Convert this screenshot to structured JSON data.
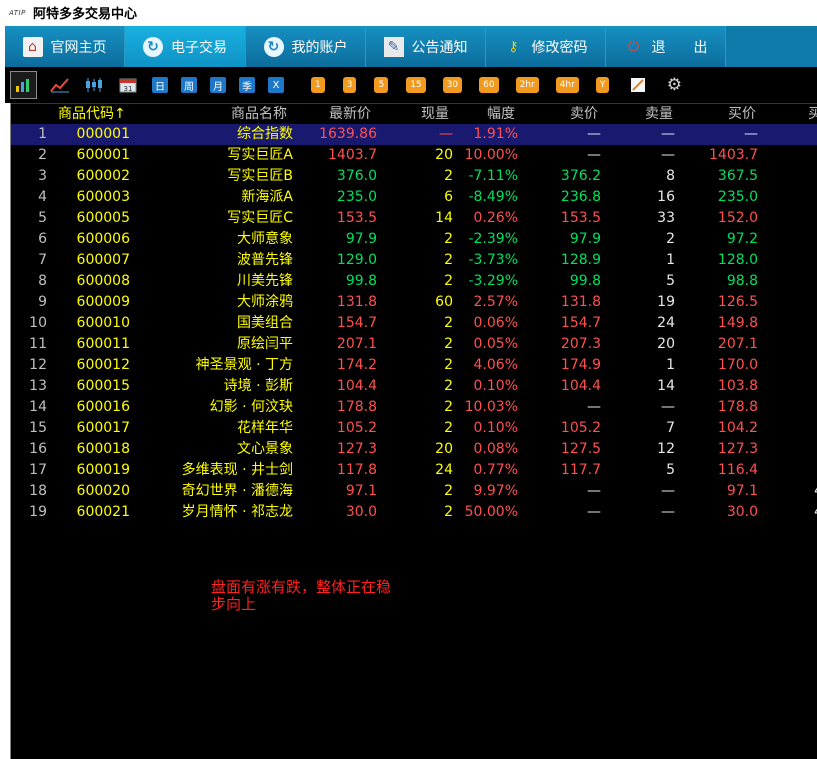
{
  "app": {
    "logo": "ATIP",
    "title": "阿特多多交易中心"
  },
  "nav": [
    {
      "label": "官网主页",
      "icon": "home-icon",
      "active": false
    },
    {
      "label": "电子交易",
      "icon": "trade-icon",
      "active": true
    },
    {
      "label": "我的账户",
      "icon": "account-icon",
      "active": false
    },
    {
      "label": "公告通知",
      "icon": "announcement-icon",
      "active": false
    },
    {
      "label": "修改密码",
      "icon": "key-icon",
      "active": false
    },
    {
      "label": "退　　出",
      "icon": "power-icon",
      "active": false
    }
  ],
  "toolbar": {
    "icons": [
      "bar-chart-icon",
      "line-chart-icon",
      "candlestick-icon",
      "calendar-icon"
    ],
    "periods": [
      "日",
      "周",
      "月",
      "季",
      "X"
    ],
    "intervals": [
      "1",
      "3",
      "5",
      "15",
      "30",
      "60",
      "2hr",
      "4hr",
      "Y"
    ],
    "tools": [
      "draw-icon",
      "gear-icon"
    ]
  },
  "table": {
    "headers": {
      "num": "",
      "code": "商品代码↑",
      "name": "商品名称",
      "last": "最新价",
      "vol": "现量",
      "change": "幅度",
      "ask": "卖价",
      "askvol": "卖量",
      "bid": "买价",
      "bidvol": "买"
    },
    "rows": [
      {
        "num": "1",
        "code": "000001",
        "name": "综合指数",
        "last": "1639.86",
        "vol": "—",
        "change": "1.91%",
        "ask": "—",
        "askvol": "—",
        "bid": "—",
        "bidvol": ""
      },
      {
        "num": "2",
        "code": "600001",
        "name": "写实巨匠A",
        "last": "1403.7",
        "vol": "20",
        "change": "10.00%",
        "ask": "—",
        "askvol": "—",
        "bid": "1403.7",
        "bidvol": ""
      },
      {
        "num": "3",
        "code": "600002",
        "name": "写实巨匠B",
        "last": "376.0",
        "vol": "2",
        "change": "-7.11%",
        "ask": "376.2",
        "askvol": "8",
        "bid": "367.5",
        "bidvol": ""
      },
      {
        "num": "4",
        "code": "600003",
        "name": "新海派A",
        "last": "235.0",
        "vol": "6",
        "change": "-8.49%",
        "ask": "236.8",
        "askvol": "16",
        "bid": "235.0",
        "bidvol": ""
      },
      {
        "num": "5",
        "code": "600005",
        "name": "写实巨匠C",
        "last": "153.5",
        "vol": "14",
        "change": "0.26%",
        "ask": "153.5",
        "askvol": "33",
        "bid": "152.0",
        "bidvol": ""
      },
      {
        "num": "6",
        "code": "600006",
        "name": "大师意象",
        "last": "97.9",
        "vol": "2",
        "change": "-2.39%",
        "ask": "97.9",
        "askvol": "2",
        "bid": "97.2",
        "bidvol": ""
      },
      {
        "num": "7",
        "code": "600007",
        "name": "波普先锋",
        "last": "129.0",
        "vol": "2",
        "change": "-3.73%",
        "ask": "128.9",
        "askvol": "1",
        "bid": "128.0",
        "bidvol": ""
      },
      {
        "num": "8",
        "code": "600008",
        "name": "川美先锋",
        "last": "99.8",
        "vol": "2",
        "change": "-3.29%",
        "ask": "99.8",
        "askvol": "5",
        "bid": "98.8",
        "bidvol": ""
      },
      {
        "num": "9",
        "code": "600009",
        "name": "大师涂鸦",
        "last": "131.8",
        "vol": "60",
        "change": "2.57%",
        "ask": "131.8",
        "askvol": "19",
        "bid": "126.5",
        "bidvol": ""
      },
      {
        "num": "10",
        "code": "600010",
        "name": "国美组合",
        "last": "154.7",
        "vol": "2",
        "change": "0.06%",
        "ask": "154.7",
        "askvol": "24",
        "bid": "149.8",
        "bidvol": ""
      },
      {
        "num": "11",
        "code": "600011",
        "name": "原绘闫平",
        "last": "207.1",
        "vol": "2",
        "change": "0.05%",
        "ask": "207.3",
        "askvol": "20",
        "bid": "207.1",
        "bidvol": ""
      },
      {
        "num": "12",
        "code": "600012",
        "name": "神圣景观 · 丁方",
        "last": "174.2",
        "vol": "2",
        "change": "4.06%",
        "ask": "174.9",
        "askvol": "1",
        "bid": "170.0",
        "bidvol": ""
      },
      {
        "num": "13",
        "code": "600015",
        "name": "诗境 · 彭斯",
        "last": "104.4",
        "vol": "2",
        "change": "0.10%",
        "ask": "104.4",
        "askvol": "14",
        "bid": "103.8",
        "bidvol": ""
      },
      {
        "num": "14",
        "code": "600016",
        "name": "幻影 · 何汶玦",
        "last": "178.8",
        "vol": "2",
        "change": "10.03%",
        "ask": "—",
        "askvol": "—",
        "bid": "178.8",
        "bidvol": ""
      },
      {
        "num": "15",
        "code": "600017",
        "name": "花样年华",
        "last": "105.2",
        "vol": "2",
        "change": "0.10%",
        "ask": "105.2",
        "askvol": "7",
        "bid": "104.2",
        "bidvol": ""
      },
      {
        "num": "16",
        "code": "600018",
        "name": "文心景象",
        "last": "127.3",
        "vol": "20",
        "change": "0.08%",
        "ask": "127.5",
        "askvol": "12",
        "bid": "127.3",
        "bidvol": ""
      },
      {
        "num": "17",
        "code": "600019",
        "name": "多维表现 · 井士剑",
        "last": "117.8",
        "vol": "24",
        "change": "0.77%",
        "ask": "117.7",
        "askvol": "5",
        "bid": "116.4",
        "bidvol": ""
      },
      {
        "num": "18",
        "code": "600020",
        "name": "奇幻世界 · 潘德海",
        "last": "97.1",
        "vol": "2",
        "change": "9.97%",
        "ask": "—",
        "askvol": "—",
        "bid": "97.1",
        "bidvol": "4"
      },
      {
        "num": "19",
        "code": "600021",
        "name": "岁月情怀 · 祁志龙",
        "last": "30.0",
        "vol": "2",
        "change": "50.00%",
        "ask": "—",
        "askvol": "—",
        "bid": "30.0",
        "bidvol": "4"
      }
    ]
  },
  "annotation": "盘面有涨有跌，整体正在稳步向上",
  "colors": {
    "up": "#ff5050",
    "down": "#00e060",
    "code": "#ffff00",
    "header_border": "#b00000",
    "selected_row": "#191970",
    "nav_bg": "#0f7bab"
  }
}
